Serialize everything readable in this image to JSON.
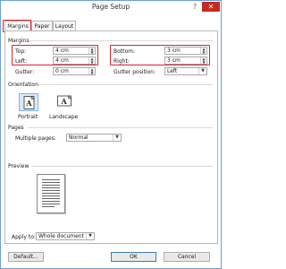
{
  "window": {
    "title": "Page Setup",
    "help_glyph": "?",
    "close_glyph": "✕"
  },
  "tabs": [
    {
      "label": "Margins",
      "active": true
    },
    {
      "label": "Paper",
      "active": false
    },
    {
      "label": "Layout",
      "active": false
    }
  ],
  "margins": {
    "section_label": "Margins",
    "top": {
      "label": "Top:",
      "value": "4 cm"
    },
    "left": {
      "label": "Left:",
      "value": "4 cm"
    },
    "gutter": {
      "label": "Gutter:",
      "value": "0 cm"
    },
    "bottom": {
      "label": "Bottom:",
      "value": "3 cm"
    },
    "right": {
      "label": "Right:",
      "value": "3 cm"
    },
    "gutter_position": {
      "label": "Gutter position:",
      "value": "Left"
    }
  },
  "orientation": {
    "section_label": "Orientation",
    "portrait_label": "Portrait",
    "landscape_label": "Landscape",
    "selected": "Portrait"
  },
  "pages": {
    "section_label": "Pages",
    "multiple_pages_label": "Multiple pages:",
    "multiple_pages_value": "Normal"
  },
  "preview": {
    "section_label": "Preview",
    "apply_to_label": "Apply to:",
    "apply_to_value": "Whole document"
  },
  "footer": {
    "default_label": "Default...",
    "ok_label": "OK",
    "cancel_label": "Cancel"
  },
  "colors": {
    "highlight": "#e0202a",
    "selected_bg": "#dbeaf9",
    "close_bg": "#c42b1c"
  }
}
